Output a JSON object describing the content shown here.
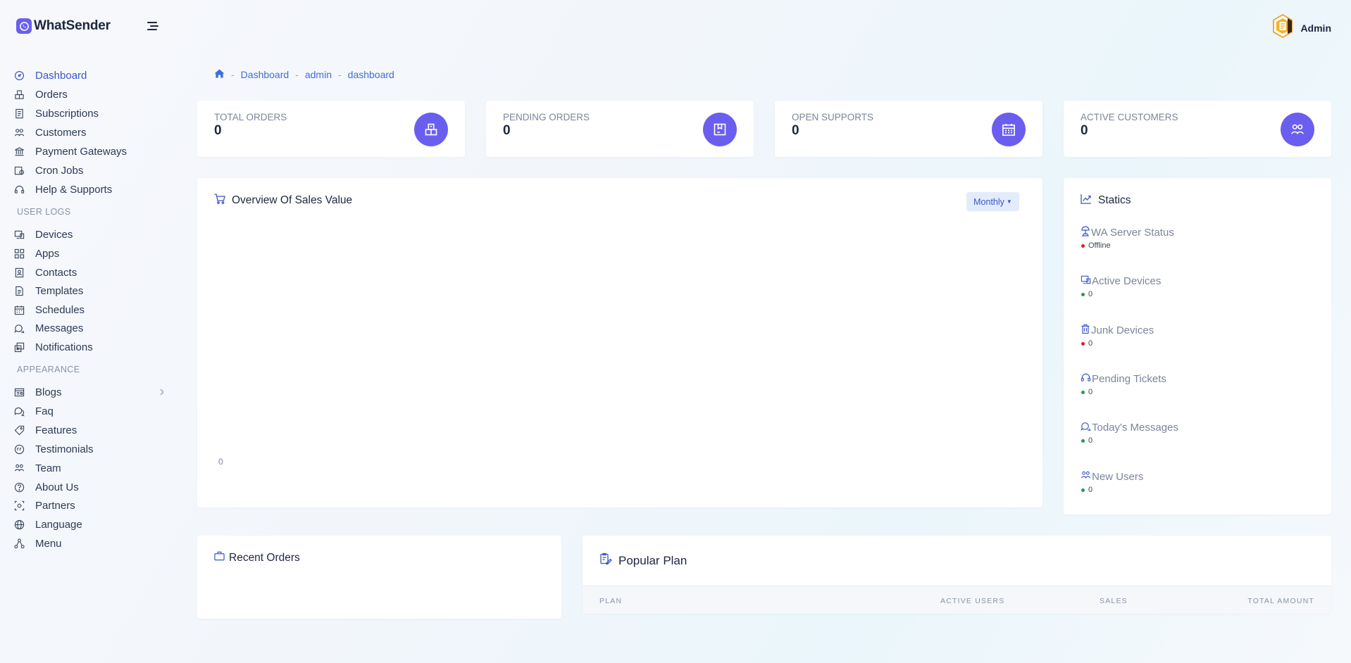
{
  "brand": {
    "name": "WhatSender"
  },
  "header": {
    "user_name": "Admin"
  },
  "sidebar": {
    "main_items": [
      {
        "label": "Dashboard",
        "icon": "dashboard-icon",
        "active": true
      },
      {
        "label": "Orders",
        "icon": "orders-icon"
      },
      {
        "label": "Subscriptions",
        "icon": "subscriptions-icon"
      },
      {
        "label": "Customers",
        "icon": "customers-icon"
      },
      {
        "label": "Payment Gateways",
        "icon": "bank-icon"
      },
      {
        "label": "Cron Jobs",
        "icon": "cron-icon"
      },
      {
        "label": "Help & Supports",
        "icon": "headset-icon"
      }
    ],
    "user_logs_title": "USER LOGS",
    "user_logs_items": [
      {
        "label": "Devices",
        "icon": "devices-icon"
      },
      {
        "label": "Apps",
        "icon": "apps-icon"
      },
      {
        "label": "Contacts",
        "icon": "contacts-icon"
      },
      {
        "label": "Templates",
        "icon": "templates-icon"
      },
      {
        "label": "Schedules",
        "icon": "calendar-icon"
      },
      {
        "label": "Messages",
        "icon": "messages-icon"
      },
      {
        "label": "Notifications",
        "icon": "notifications-icon"
      }
    ],
    "appearance_title": "APPEARANCE",
    "appearance_items": [
      {
        "label": "Blogs",
        "icon": "blogs-icon"
      },
      {
        "label": "Faq",
        "icon": "faq-icon"
      },
      {
        "label": "Features",
        "icon": "features-icon"
      },
      {
        "label": "Testimonials",
        "icon": "quote-icon"
      },
      {
        "label": "Team",
        "icon": "team-icon"
      },
      {
        "label": "About Us",
        "icon": "question-icon"
      },
      {
        "label": "Partners",
        "icon": "partners-icon"
      },
      {
        "label": "Language",
        "icon": "globe-icon"
      },
      {
        "label": "Menu",
        "icon": "sitemap-icon"
      }
    ]
  },
  "breadcrumb": {
    "items": [
      "Dashboard",
      "admin",
      "dashboard"
    ]
  },
  "stats": [
    {
      "label": "TOTAL ORDERS",
      "value": "0",
      "icon": "box-icon"
    },
    {
      "label": "PENDING ORDERS",
      "value": "0",
      "icon": "package-icon"
    },
    {
      "label": "OPEN SUPPORTS",
      "value": "0",
      "icon": "calendar-icon"
    },
    {
      "label": "ACTIVE CUSTOMERS",
      "value": "0",
      "icon": "users-icon"
    }
  ],
  "sales_overview": {
    "title": "Overview Of Sales Value",
    "period": "Monthly",
    "zero_tick": "0"
  },
  "statics": {
    "title": "Statics",
    "items": [
      {
        "label": "WA Server Status",
        "value": "Offline",
        "status_color": "#e01e1e"
      },
      {
        "label": "Active Devices",
        "value": "0",
        "status_color": "#1f9d55"
      },
      {
        "label": "Junk Devices",
        "value": "0",
        "status_color": "#e01e1e"
      },
      {
        "label": "Pending Tickets",
        "value": "0",
        "status_color": "#1f9d55"
      },
      {
        "label": "Today's Messages",
        "value": "0",
        "status_color": "#1f9d55"
      },
      {
        "label": "New Users",
        "value": "0",
        "status_color": "#1f9d55"
      }
    ]
  },
  "recent_orders": {
    "title": "Recent Orders"
  },
  "popular_plan": {
    "title": "Popular Plan",
    "columns": [
      "PLAN",
      "ACTIVE USERS",
      "SALES",
      "TOTAL AMOUNT"
    ]
  },
  "colors": {
    "accent": "#6a5ef0",
    "link": "#3b6fd8",
    "offline": "#e01e1e",
    "online": "#1f9d55"
  }
}
